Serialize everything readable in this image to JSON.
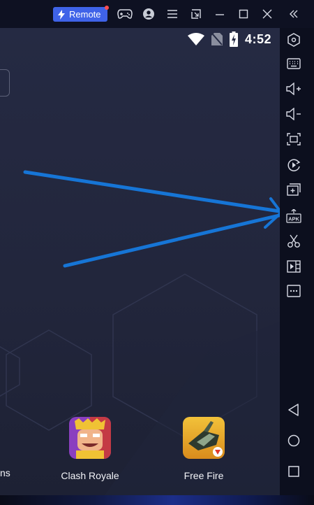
{
  "titlebar": {
    "remote_label": "Remote",
    "icons": [
      "remote-lightning-icon",
      "gamepad-icon",
      "account-icon",
      "menu-icon",
      "restore-window-icon",
      "minimize-icon",
      "maximize-icon",
      "close-icon",
      "collapse-sidebar-icon"
    ]
  },
  "statusbar": {
    "time": "4:52",
    "icons": [
      "wifi-icon",
      "no-sim-icon",
      "battery-charging-icon"
    ]
  },
  "apps": [
    {
      "label": "Clash Royale",
      "icon": "clash-royale-icon"
    },
    {
      "label": "Free Fire",
      "icon": "free-fire-icon"
    }
  ],
  "partial_app_label": "ns",
  "sidebar": {
    "tools": [
      "settings-hex-icon",
      "keyboard-icon",
      "volume-up-icon",
      "volume-down-icon",
      "screen-capture-icon",
      "rotate-screen-icon",
      "multi-instance-icon",
      "install-apk-icon",
      "scissors-icon",
      "media-icon",
      "more-icon"
    ],
    "nav": [
      "back-icon",
      "home-icon",
      "recents-icon"
    ],
    "apk_text": "APK"
  },
  "annotation": {
    "arrow_color": "#1675d6",
    "arrows_point_to": "install-apk-icon"
  },
  "colors": {
    "accent": "#3f63e8",
    "screen_bg": "#252a43",
    "titlebar_bg": "#0e1122"
  }
}
